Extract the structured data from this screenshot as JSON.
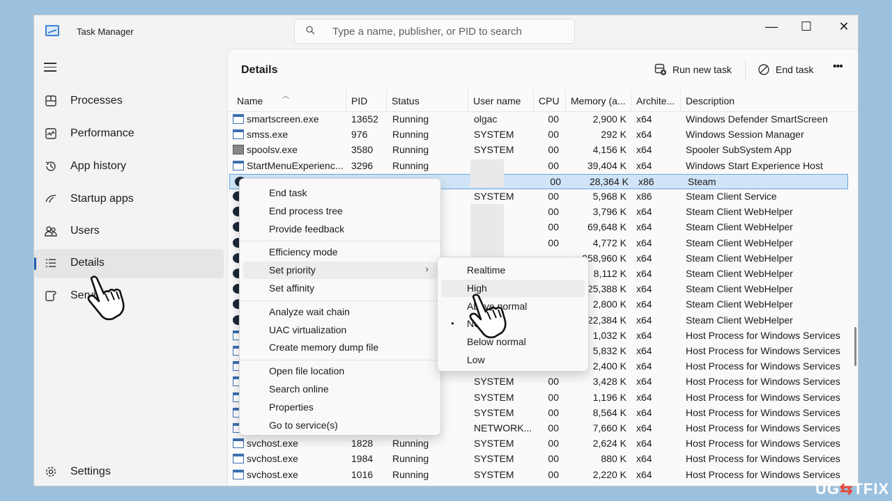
{
  "window": {
    "title": "Task Manager",
    "search_placeholder": "Type a name, publisher, or PID to search",
    "controls": {
      "minimize": "—",
      "maximize": "☐",
      "close": "✕"
    }
  },
  "sidebar": {
    "items": [
      {
        "label": "Processes",
        "icon": "processes-icon"
      },
      {
        "label": "Performance",
        "icon": "performance-icon"
      },
      {
        "label": "App history",
        "icon": "app-history-icon"
      },
      {
        "label": "Startup apps",
        "icon": "startup-apps-icon"
      },
      {
        "label": "Users",
        "icon": "users-icon"
      },
      {
        "label": "Details",
        "icon": "details-icon",
        "active": true
      },
      {
        "label": "Services",
        "icon": "services-icon"
      }
    ],
    "settings_label": "Settings"
  },
  "main": {
    "title": "Details",
    "run_new_task": "Run new task",
    "end_task": "End task",
    "more": "•••"
  },
  "columns": [
    "Name",
    "PID",
    "Status",
    "User name",
    "CPU",
    "Memory (a...",
    "Archite...",
    "Description"
  ],
  "rows": [
    {
      "name": "smartscreen.exe",
      "pid": "13652",
      "status": "Running",
      "user": "olgac",
      "cpu": "00",
      "mem": "2,900 K",
      "arch": "x64",
      "desc": "Windows Defender SmartScreen",
      "icon": "app"
    },
    {
      "name": "smss.exe",
      "pid": "976",
      "status": "Running",
      "user": "SYSTEM",
      "cpu": "00",
      "mem": "292 K",
      "arch": "x64",
      "desc": "Windows Session Manager",
      "icon": "app"
    },
    {
      "name": "spoolsv.exe",
      "pid": "3580",
      "status": "Running",
      "user": "SYSTEM",
      "cpu": "00",
      "mem": "4,156 K",
      "arch": "x64",
      "desc": "Spooler SubSystem App",
      "icon": "printer"
    },
    {
      "name": "StartMenuExperienc...",
      "pid": "3296",
      "status": "Running",
      "user": "",
      "cpu": "00",
      "mem": "39,404 K",
      "arch": "x64",
      "desc": "Windows Start Experience Host",
      "icon": "app"
    },
    {
      "name": "",
      "pid": "",
      "status": "",
      "user": "",
      "cpu": "00",
      "mem": "28,364 K",
      "arch": "x86",
      "desc": "Steam",
      "icon": "steam",
      "selected": true
    },
    {
      "name": "",
      "pid": "",
      "status": "",
      "user": "SYSTEM",
      "cpu": "00",
      "mem": "5,968 K",
      "arch": "x86",
      "desc": "Steam Client Service",
      "icon": "steam"
    },
    {
      "name": "",
      "pid": "",
      "status": "",
      "user": "",
      "cpu": "00",
      "mem": "3,796 K",
      "arch": "x64",
      "desc": "Steam Client WebHelper",
      "icon": "steam"
    },
    {
      "name": "",
      "pid": "",
      "status": "",
      "user": "",
      "cpu": "00",
      "mem": "69,648 K",
      "arch": "x64",
      "desc": "Steam Client WebHelper",
      "icon": "steam"
    },
    {
      "name": "",
      "pid": "",
      "status": "",
      "user": "",
      "cpu": "00",
      "mem": "4,772 K",
      "arch": "x64",
      "desc": "Steam Client WebHelper",
      "icon": "steam"
    },
    {
      "name": "",
      "pid": "",
      "status": "",
      "user": "",
      "cpu": "",
      "mem": "258,960 K",
      "arch": "x64",
      "desc": "Steam Client WebHelper",
      "icon": "steam"
    },
    {
      "name": "",
      "pid": "",
      "status": "",
      "user": "",
      "cpu": "",
      "mem": "8,112 K",
      "arch": "x64",
      "desc": "Steam Client WebHelper",
      "icon": "steam"
    },
    {
      "name": "",
      "pid": "",
      "status": "",
      "user": "",
      "cpu": "",
      "mem": "25,388 K",
      "arch": "x64",
      "desc": "Steam Client WebHelper",
      "icon": "steam"
    },
    {
      "name": "",
      "pid": "",
      "status": "",
      "user": "",
      "cpu": "",
      "mem": "2,800 K",
      "arch": "x64",
      "desc": "Steam Client WebHelper",
      "icon": "steam"
    },
    {
      "name": "",
      "pid": "",
      "status": "",
      "user": "",
      "cpu": "",
      "mem": "22,384 K",
      "arch": "x64",
      "desc": "Steam Client WebHelper",
      "icon": "steam"
    },
    {
      "name": "",
      "pid": "",
      "status": "",
      "user": "",
      "cpu": "",
      "mem": "1,032 K",
      "arch": "x64",
      "desc": "Host Process for Windows Services",
      "icon": "app"
    },
    {
      "name": "",
      "pid": "",
      "status": "",
      "user": "",
      "cpu": "",
      "mem": "5,832 K",
      "arch": "x64",
      "desc": "Host Process for Windows Services",
      "icon": "app"
    },
    {
      "name": "",
      "pid": "",
      "status": "",
      "user": "",
      "cpu": "",
      "mem": "2,400 K",
      "arch": "x64",
      "desc": "Host Process for Windows Services",
      "icon": "app"
    },
    {
      "name": "",
      "pid": "",
      "status": "",
      "user": "SYSTEM",
      "cpu": "00",
      "mem": "3,428 K",
      "arch": "x64",
      "desc": "Host Process for Windows Services",
      "icon": "app"
    },
    {
      "name": "",
      "pid": "",
      "status": "",
      "user": "SYSTEM",
      "cpu": "00",
      "mem": "1,196 K",
      "arch": "x64",
      "desc": "Host Process for Windows Services",
      "icon": "app"
    },
    {
      "name": "",
      "pid": "",
      "status": "",
      "user": "SYSTEM",
      "cpu": "00",
      "mem": "8,564 K",
      "arch": "x64",
      "desc": "Host Process for Windows Services",
      "icon": "app"
    },
    {
      "name": "",
      "pid": "",
      "status": "",
      "user": "NETWORK...",
      "cpu": "00",
      "mem": "7,660 K",
      "arch": "x64",
      "desc": "Host Process for Windows Services",
      "icon": "app"
    },
    {
      "name": "svchost.exe",
      "pid": "1828",
      "status": "Running",
      "user": "SYSTEM",
      "cpu": "00",
      "mem": "2,624 K",
      "arch": "x64",
      "desc": "Host Process for Windows Services",
      "icon": "app"
    },
    {
      "name": "svchost.exe",
      "pid": "1984",
      "status": "Running",
      "user": "SYSTEM",
      "cpu": "00",
      "mem": "880 K",
      "arch": "x64",
      "desc": "Host Process for Windows Services",
      "icon": "app"
    },
    {
      "name": "svchost.exe",
      "pid": "1016",
      "status": "Running",
      "user": "SYSTEM",
      "cpu": "00",
      "mem": "2,220 K",
      "arch": "x64",
      "desc": "Host Process for Windows Services",
      "icon": "app"
    }
  ],
  "context_menu": {
    "groups": [
      [
        "End task",
        "End process tree",
        "Provide feedback"
      ],
      [
        "Efficiency mode",
        "Set priority",
        "Set affinity"
      ],
      [
        "Analyze wait chain",
        "UAC virtualization",
        "Create memory dump file"
      ],
      [
        "Open file location",
        "Search online",
        "Properties",
        "Go to service(s)"
      ]
    ],
    "hovered": "Set priority"
  },
  "priority_menu": {
    "items": [
      "Realtime",
      "High",
      "Above normal",
      "Normal",
      "Below normal",
      "Low"
    ],
    "hovered": "High",
    "checked": "Normal"
  },
  "watermark": {
    "left": "U",
    "mid": "G",
    "accent": "⇆",
    "right": "TFIX"
  }
}
